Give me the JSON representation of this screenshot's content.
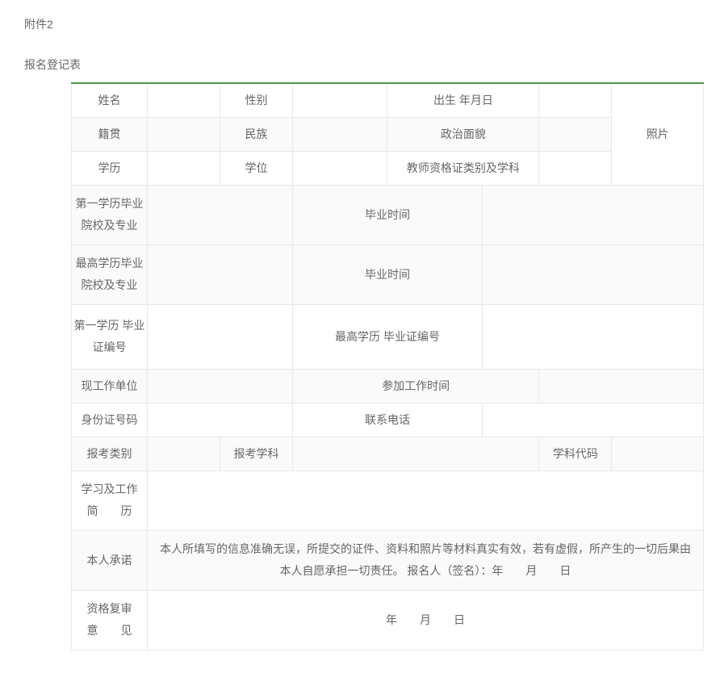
{
  "header": {
    "attachment": "附件2",
    "title": "报名登记表"
  },
  "labels": {
    "name": "姓名",
    "gender": "性别",
    "birth": "出生 年月日",
    "native_place": "籍贯",
    "ethnicity": "民族",
    "political": "政治面貌",
    "education": "学历",
    "degree": "学位",
    "teacher_cert": "教师资格证类别及学科",
    "photo": "照片",
    "first_school": "第一学历毕业院校及专业",
    "highest_school": "最高学历毕业院校及专业",
    "grad_time": "毕业时间",
    "first_cert_no": "第一学历 毕业证编号",
    "highest_cert_no": "最高学历 毕业证编号",
    "work_unit": "现工作单位",
    "work_start": "参加工作时间",
    "id_number": "身份证号码",
    "phone": "联系电话",
    "exam_category": "报考类别",
    "exam_subject": "报考学科",
    "subject_code": "学科代码",
    "resume_label_1": "学习及工作",
    "resume_label_2": "简　　历",
    "commitment_label": "本人承诺",
    "commitment_text": "本人所填写的信息准确无误，所提交的证件、资料和照片等材料真实有效，若有虚假，所产生的一切后果由本人自愿承担一切责任。 报名人（签名）：年　　月　　日",
    "review_label_1": "资格复审",
    "review_label_2": "意　　见",
    "review_text": "年　　月　　日"
  }
}
